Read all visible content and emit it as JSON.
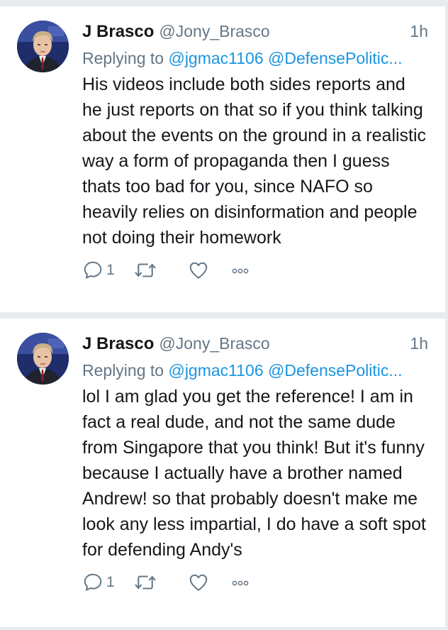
{
  "tweets": [
    {
      "author_name": "J Brasco",
      "author_handle": "@Jony_Brasco",
      "time": "1h",
      "replying_prefix": "Replying to",
      "replying_mentions": [
        "@jgmac1106",
        "@DefensePolitic..."
      ],
      "text": "His videos include both sides reports and he just reports on that so if you think talking about the events on the ground in a realistic way a form of propaganda then I guess thats too bad for you, since NAFO so heavily relies on disinformation and people not doing their homework",
      "reply_count": "1"
    },
    {
      "author_name": "J Brasco",
      "author_handle": "@Jony_Brasco",
      "time": "1h",
      "replying_prefix": "Replying to",
      "replying_mentions": [
        "@jgmac1106",
        "@DefensePolitic..."
      ],
      "text": "lol I am glad you get the reference! I am in fact a real dude, and not the same dude from Singapore that you think! But it's funny  because I actually have a brother named Andrew! so that probably doesn't make me look any less impartial, I do have a soft spot for defending Andy's",
      "reply_count": "1"
    }
  ],
  "icons": {
    "reply": "reply-icon",
    "retweet": "retweet-icon",
    "like": "heart-icon",
    "more": "more-icon"
  },
  "colors": {
    "text": "#14171a",
    "secondary": "#657786",
    "link": "#1b95e0",
    "background": "#e6ecf0"
  }
}
